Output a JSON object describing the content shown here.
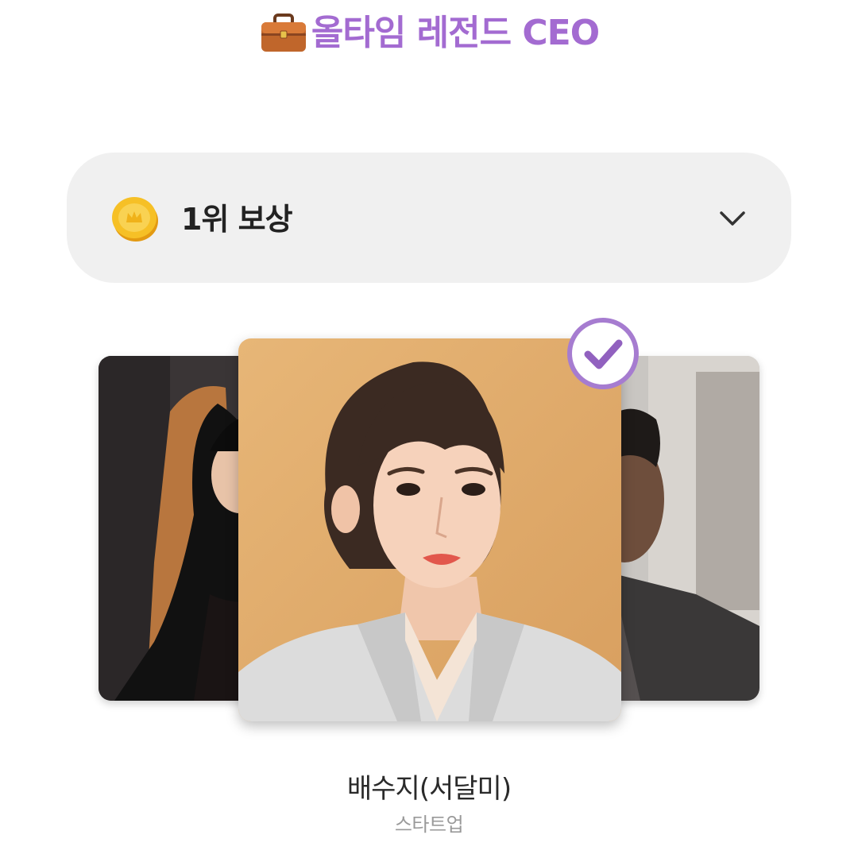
{
  "header": {
    "icon": "briefcase-icon",
    "title": "올타임 레전드 CEO",
    "title_color": "#a36bd1"
  },
  "reward": {
    "icon": "coin-icon",
    "label": "1위 보상",
    "toggle_icon": "chevron-down-icon",
    "background": "#f0f0f0"
  },
  "carousel": {
    "selected_badge_icon": "check-circle-icon",
    "accent": "#a36bd1",
    "cards": [
      {
        "position": "left",
        "selected": false
      },
      {
        "position": "center",
        "selected": true
      },
      {
        "position": "right",
        "selected": false
      }
    ]
  },
  "selected_character": {
    "name": "배수지(서달미)",
    "subtitle": "스타트업"
  }
}
